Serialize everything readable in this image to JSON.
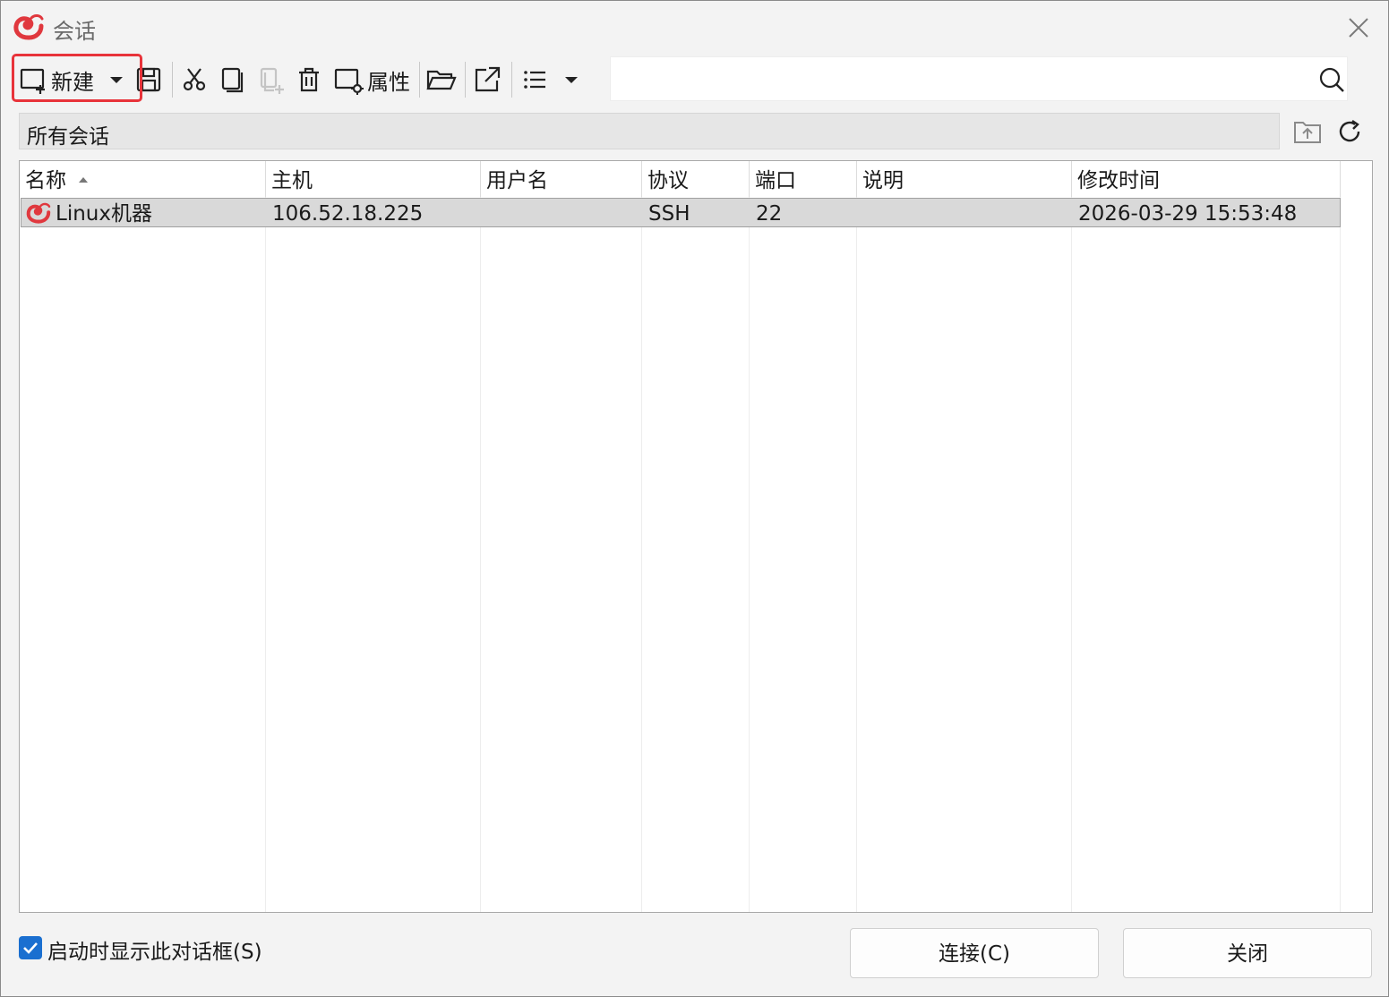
{
  "window": {
    "title": "会话",
    "title_color": "#6a6a6a"
  },
  "toolbar": {
    "new_label": "新建",
    "properties_label": "属性",
    "highlight_color": "#e8333a",
    "buttons": [
      "new",
      "dropdown",
      "save",
      "cut",
      "copy",
      "paste",
      "delete",
      "properties",
      "open-folder",
      "export",
      "view-list",
      "view-dropdown"
    ]
  },
  "search": {
    "value": "",
    "placeholder": ""
  },
  "path": {
    "label": "所有会话"
  },
  "table": {
    "columns": [
      "名称",
      "主机",
      "用户名",
      "协议",
      "端口",
      "说明",
      "修改时间"
    ],
    "sort_column": "名称",
    "sort_direction": "ascending",
    "rows": [
      {
        "name": "Linux机器",
        "host": "106.52.18.225",
        "user": "",
        "protocol": "SSH",
        "port": "22",
        "description": "",
        "modified": "2026-03-29 15:53:48",
        "selected": true
      }
    ]
  },
  "footer": {
    "show_on_startup_label": "启动时显示此对话框(S)",
    "show_on_startup_checked": true,
    "connect_label": "连接(C)",
    "close_label": "关闭",
    "accent_color": "#1a6fd0"
  }
}
